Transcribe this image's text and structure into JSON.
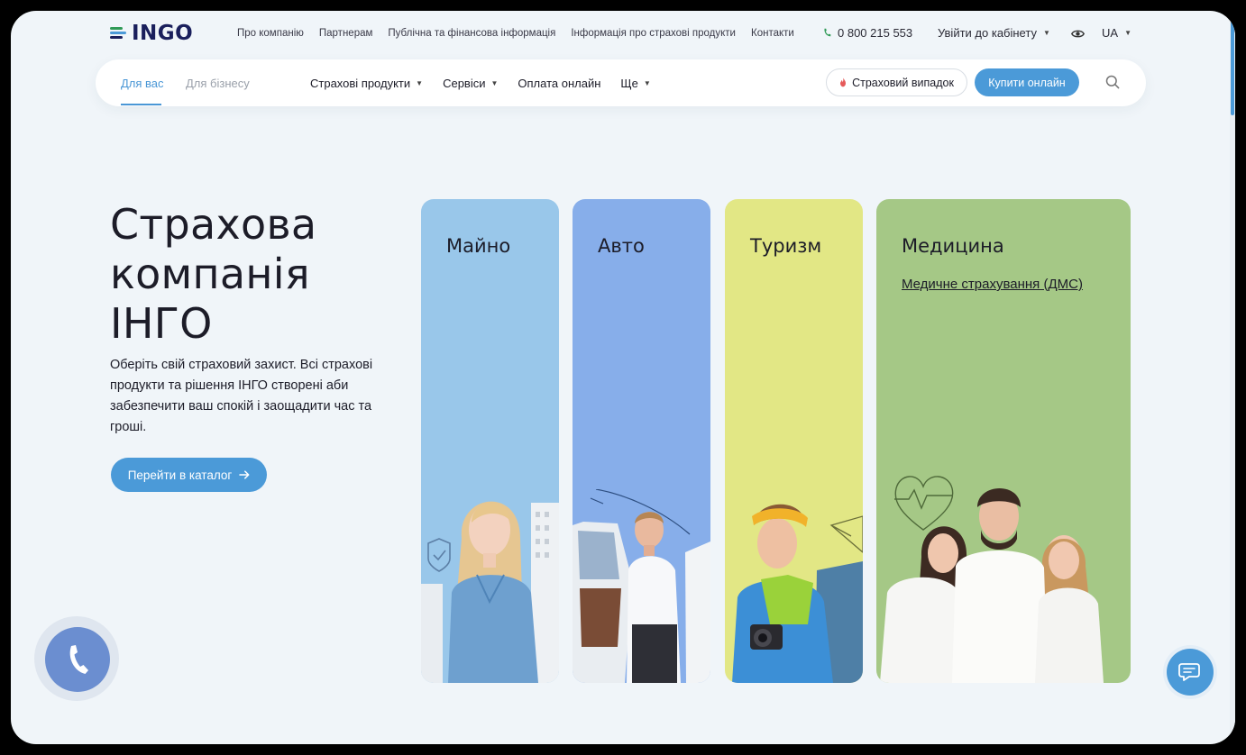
{
  "brand": {
    "name": "INGO",
    "colors": {
      "primary": "#4b9ad8",
      "navy": "#1a1f5c",
      "background": "#f0f5f9"
    }
  },
  "topbar": {
    "links": [
      "Про компанію",
      "Партнерам",
      "Публічна та фінансова інформація",
      "Інформація про страхові продукти",
      "Контакти"
    ],
    "phone": "0 800 215 553",
    "cabinet": "Увійти до кабінету",
    "lang": "UA"
  },
  "nav": {
    "tab_active": "Для вас",
    "tab_inactive": "Для бізнесу",
    "menu": [
      "Страхові продукти",
      "Сервіси",
      "Оплата онлайн",
      "Ще"
    ],
    "claim_button": "Страховий випадок",
    "buy_button": "Купити онлайн"
  },
  "hero": {
    "title_line1": "Страхова",
    "title_line2": "компанія",
    "title_line3": "ІНГО",
    "text": "Оберіть свій страховий захист. Всі страхові продукти та рішення ІНГО створені аби забезпечити ваш спокій і заощадити час та гроші.",
    "catalog_button": "Перейти в каталог"
  },
  "cards": [
    {
      "title": "Майно",
      "color": "#99c7ea"
    },
    {
      "title": "Авто",
      "color": "#87aeea"
    },
    {
      "title": "Туризм",
      "color": "#e2e785"
    },
    {
      "title": "Медицина",
      "color": "#a5c886",
      "link": "Медичне страхування (ДМС)"
    }
  ],
  "icons": [
    "phone-icon",
    "eye-icon",
    "search-icon",
    "flame-icon",
    "arrow-right-icon",
    "call-icon",
    "chat-icon"
  ]
}
